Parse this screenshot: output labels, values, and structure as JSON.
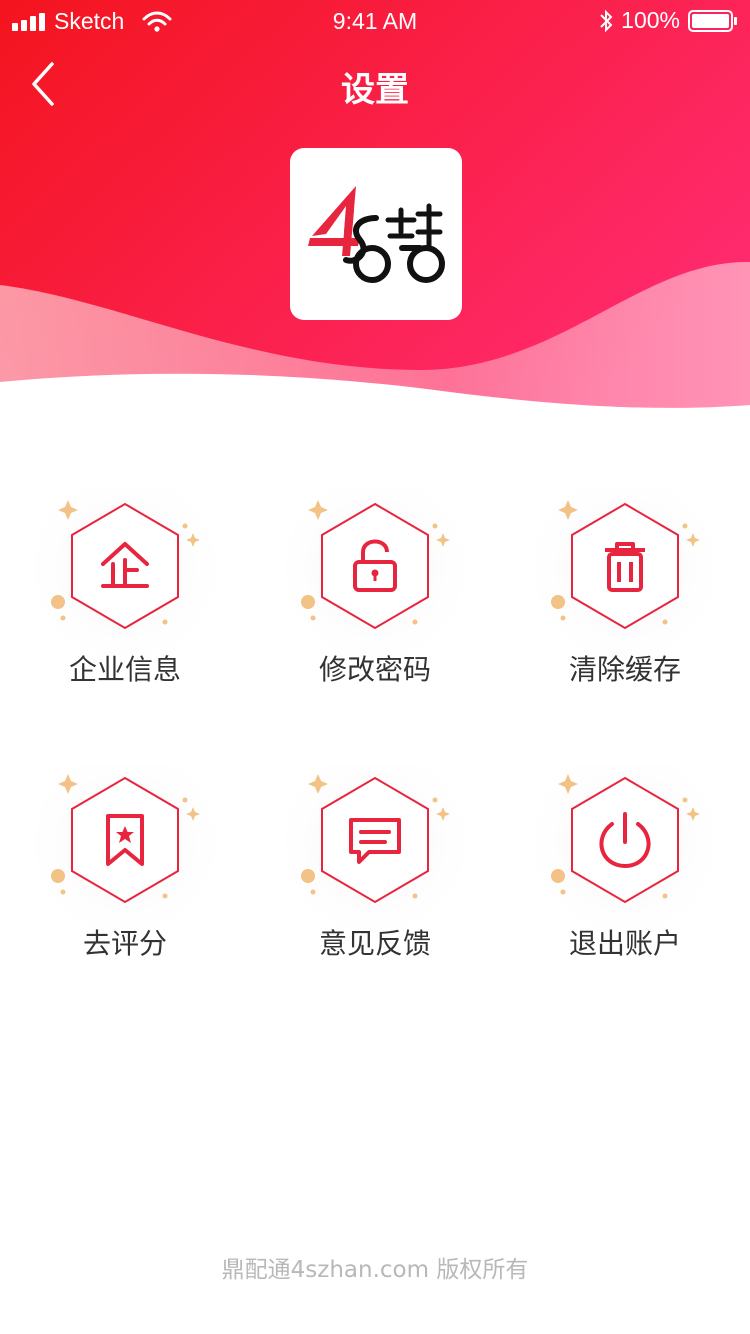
{
  "status_bar": {
    "carrier": "Sketch",
    "time": "9:41 AM",
    "battery": "100%"
  },
  "nav": {
    "title": "设置",
    "back_icon": "chevron-left-icon"
  },
  "logo": {
    "name": "4s-station-logo",
    "text": "4S站"
  },
  "menu": {
    "items": [
      {
        "label": "企业信息",
        "icon": "enterprise-icon"
      },
      {
        "label": "修改密码",
        "icon": "unlock-icon"
      },
      {
        "label": "清除缓存",
        "icon": "trash-icon"
      },
      {
        "label": "去评分",
        "icon": "bookmark-star-icon"
      },
      {
        "label": "意见反馈",
        "icon": "message-icon"
      },
      {
        "label": "退出账户",
        "icon": "power-icon"
      }
    ]
  },
  "footer": {
    "copyright": "鼎配通4szhan.com 版权所有"
  },
  "colors": {
    "accent": "#e8253f",
    "header_start": "#f4141e",
    "header_end": "#ff2a6d",
    "sparkle": "#f2c287"
  }
}
